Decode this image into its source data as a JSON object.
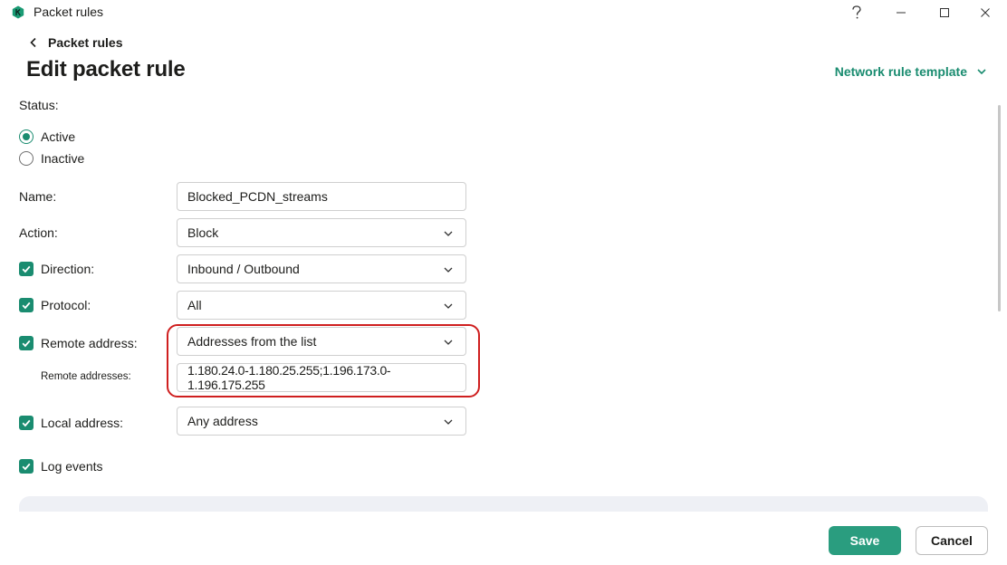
{
  "window": {
    "title": "Packet rules",
    "help_icon": "question-icon",
    "minimize_icon": "minimize-icon",
    "maximize_icon": "maximize-icon",
    "close_icon": "close-icon"
  },
  "header": {
    "back_label": "Packet rules",
    "page_title": "Edit packet rule",
    "template_link": "Network rule template"
  },
  "form": {
    "status_label": "Status:",
    "status_options": [
      {
        "label": "Active",
        "selected": true
      },
      {
        "label": "Inactive",
        "selected": false
      }
    ],
    "name": {
      "label": "Name:",
      "value": "Blocked_PCDN_streams"
    },
    "action": {
      "label": "Action:",
      "value": "Block"
    },
    "direction": {
      "label": "Direction:",
      "checked": true,
      "value": "Inbound / Outbound"
    },
    "protocol": {
      "label": "Protocol:",
      "checked": true,
      "value": "All"
    },
    "remote_address": {
      "label": "Remote address:",
      "checked": true,
      "value": "Addresses from the list"
    },
    "remote_addresses": {
      "label": "Remote addresses:",
      "value": "1.180.24.0-1.180.25.255;1.196.173.0-1.196.175.255"
    },
    "local_address": {
      "label": "Local address:",
      "checked": true,
      "value": "Any address"
    },
    "log_events": {
      "label": "Log events",
      "checked": true
    }
  },
  "footer": {
    "save_label": "Save",
    "cancel_label": "Cancel"
  },
  "colors": {
    "accent": "#1a8c70",
    "save_button": "#2a9d7f",
    "highlight": "#cf1f1f"
  }
}
